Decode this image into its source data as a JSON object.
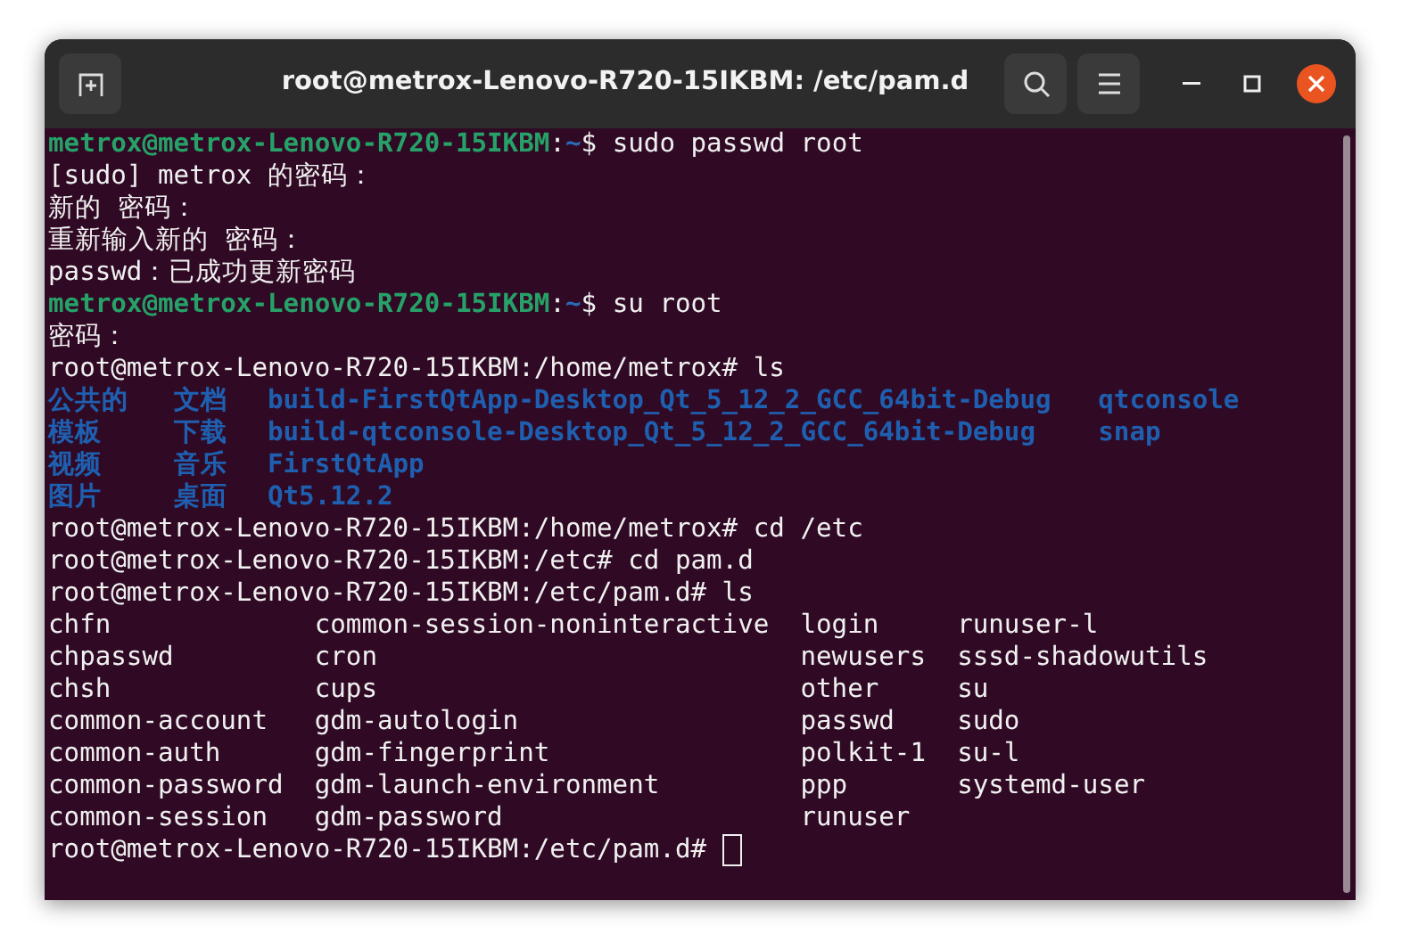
{
  "window": {
    "title": "root@metrox-Lenovo-R720-15IKBM: /etc/pam.d"
  },
  "terminal": {
    "lines": [
      {
        "kind": "prompt",
        "segments": [
          {
            "kind": "host",
            "text": "metrox@metrox-Lenovo-R720-15IKBM"
          },
          {
            "kind": "plain",
            "text": ":"
          },
          {
            "kind": "path",
            "text": "~"
          },
          {
            "kind": "plain",
            "text": "$ sudo passwd root"
          }
        ]
      },
      {
        "kind": "text",
        "text": "[sudo] metrox 的密码："
      },
      {
        "kind": "text",
        "text": "新的 密码："
      },
      {
        "kind": "text",
        "text": "重新输入新的 密码："
      },
      {
        "kind": "text",
        "text": "passwd：已成功更新密码"
      },
      {
        "kind": "prompt",
        "segments": [
          {
            "kind": "host",
            "text": "metrox@metrox-Lenovo-R720-15IKBM"
          },
          {
            "kind": "plain",
            "text": ":"
          },
          {
            "kind": "path",
            "text": "~"
          },
          {
            "kind": "plain",
            "text": "$ su root"
          }
        ]
      },
      {
        "kind": "text",
        "text": "密码："
      },
      {
        "kind": "text",
        "text": "root@metrox-Lenovo-R720-15IKBM:/home/metrox# ls"
      },
      {
        "kind": "dirlisting",
        "rows": [
          [
            {
              "kind": "dir",
              "text": "公共的"
            },
            {
              "kind": "dir",
              "text": "文档"
            },
            {
              "kind": "dir",
              "text": "build-FirstQtApp-Desktop_Qt_5_12_2_GCC_64bit-Debug"
            },
            {
              "kind": "dir",
              "text": "qtconsole"
            }
          ],
          [
            {
              "kind": "dir",
              "text": "模板"
            },
            {
              "kind": "dir",
              "text": "下载"
            },
            {
              "kind": "dir",
              "text": "build-qtconsole-Desktop_Qt_5_12_2_GCC_64bit-Debug"
            },
            {
              "kind": "dir",
              "text": "snap"
            }
          ],
          [
            {
              "kind": "dir",
              "text": "视频"
            },
            {
              "kind": "dir",
              "text": "音乐"
            },
            {
              "kind": "dir",
              "text": "FirstQtApp"
            }
          ],
          [
            {
              "kind": "dir",
              "text": "图片"
            },
            {
              "kind": "dir",
              "text": "桌面"
            },
            {
              "kind": "dir",
              "text": "Qt5.12.2"
            }
          ]
        ]
      },
      {
        "kind": "text",
        "text": "root@metrox-Lenovo-R720-15IKBM:/home/metrox# cd /etc"
      },
      {
        "kind": "text",
        "text": "root@metrox-Lenovo-R720-15IKBM:/etc# cd pam.d"
      },
      {
        "kind": "text",
        "text": "root@metrox-Lenovo-R720-15IKBM:/etc/pam.d# ls"
      },
      {
        "kind": "filelisting",
        "rows": [
          [
            {
              "kind": "file",
              "text": "chfn"
            },
            {
              "kind": "file",
              "text": "common-session-noninteractive"
            },
            {
              "kind": "file",
              "text": "login"
            },
            {
              "kind": "file",
              "text": "runuser-l"
            }
          ],
          [
            {
              "kind": "file",
              "text": "chpasswd"
            },
            {
              "kind": "file",
              "text": "cron"
            },
            {
              "kind": "file",
              "text": "newusers"
            },
            {
              "kind": "file",
              "text": "sssd-shadowutils"
            }
          ],
          [
            {
              "kind": "file",
              "text": "chsh"
            },
            {
              "kind": "file",
              "text": "cups"
            },
            {
              "kind": "file",
              "text": "other"
            },
            {
              "kind": "file",
              "text": "su"
            }
          ],
          [
            {
              "kind": "file",
              "text": "common-account"
            },
            {
              "kind": "file",
              "text": "gdm-autologin"
            },
            {
              "kind": "file",
              "text": "passwd"
            },
            {
              "kind": "file",
              "text": "sudo"
            }
          ],
          [
            {
              "kind": "file",
              "text": "common-auth"
            },
            {
              "kind": "file",
              "text": "gdm-fingerprint"
            },
            {
              "kind": "file",
              "text": "polkit-1"
            },
            {
              "kind": "file",
              "text": "su-l"
            }
          ],
          [
            {
              "kind": "file",
              "text": "common-password"
            },
            {
              "kind": "file",
              "text": "gdm-launch-environment"
            },
            {
              "kind": "file",
              "text": "ppp"
            },
            {
              "kind": "file",
              "text": "systemd-user"
            }
          ],
          [
            {
              "kind": "file",
              "text": "common-session"
            },
            {
              "kind": "file",
              "text": "gdm-password"
            },
            {
              "kind": "file",
              "text": "runuser"
            }
          ]
        ]
      },
      {
        "kind": "input",
        "text": "root@metrox-Lenovo-R720-15IKBM:/etc/pam.d# "
      }
    ]
  }
}
